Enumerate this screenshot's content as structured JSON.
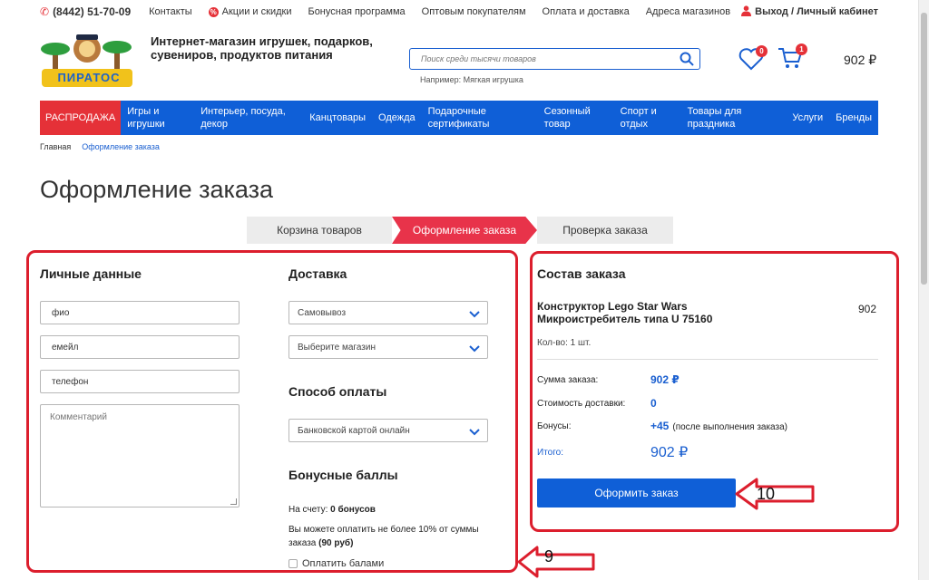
{
  "topbar": {
    "phone": "(8442) 51-70-09",
    "links": [
      "Контакты",
      "Акции и скидки",
      "Бонусная программа",
      "Оптовым покупателям",
      "Оплата и доставка",
      "Адреса магазинов"
    ],
    "promo_badge": "%",
    "account": "Выход / Личный кабинет"
  },
  "header": {
    "tagline": "Интернет-магазин игрушек, подарков, сувениров, продуктов питания",
    "logo_text": "ПИРАТОС",
    "search_placeholder": "Поиск среди тысячи товаров",
    "search_hint": "Например: Мягкая игрушка",
    "favorites_count": "0",
    "cart_count": "1",
    "cart_total": "902 ₽"
  },
  "nav": {
    "sale": "РАСПРОДАЖА",
    "items": [
      "Игры и игрушки",
      "Интерьер, посуда, декор",
      "Канцтовары",
      "Одежда",
      "Подарочные сертификаты",
      "Сезонный товар",
      "Спорт и отдых",
      "Товары для праздника",
      "Услуги",
      "Бренды"
    ]
  },
  "breadcrumb": {
    "home": "Главная",
    "current": "Оформление заказа"
  },
  "page_title": "Оформление заказа",
  "steps": [
    "Корзина товаров",
    "Оформление заказа",
    "Проверка заказа"
  ],
  "personal": {
    "title": "Личные данные",
    "name_value": "фио",
    "email_value": "емейл",
    "phone_value": "телефон",
    "comment_placeholder": "Комментарий"
  },
  "delivery": {
    "title": "Доставка",
    "method": "Самовывоз",
    "store_placeholder": "Выберите магазин"
  },
  "payment": {
    "title": "Способ оплаты",
    "method": "Банковской картой онлайн"
  },
  "bonus": {
    "title": "Бонусные баллы",
    "balance_label": "На счету:",
    "balance_value": "0 бонусов",
    "limit_text": "Вы можете оплатить не более 10% от суммы заказа",
    "limit_value": "(90 руб)",
    "pay_with_points": "Оплатить балами"
  },
  "summary": {
    "title": "Состав заказа",
    "product_name": "Конструктор Lego Star Wars Микроистребитель типа U 75160",
    "product_price": "902",
    "quantity": "Кол-во: 1 шт.",
    "order_sum_label": "Сумма заказа:",
    "order_sum_value": "902 ₽",
    "delivery_cost_label": "Стоимость доставки:",
    "delivery_cost_value": "0",
    "bonuses_label": "Бонусы:",
    "bonuses_value": "+45",
    "bonuses_note": "(после выполнения заказа)",
    "total_label": "Итого:",
    "total_value": "902 ₽",
    "submit_button": "Оформить заказ"
  },
  "annotations": {
    "left_label": "9",
    "right_label": "10"
  },
  "colors": {
    "accent_blue": "#0f5fd7",
    "accent_red": "#e53138",
    "annotation_red": "#dc1e2d"
  }
}
